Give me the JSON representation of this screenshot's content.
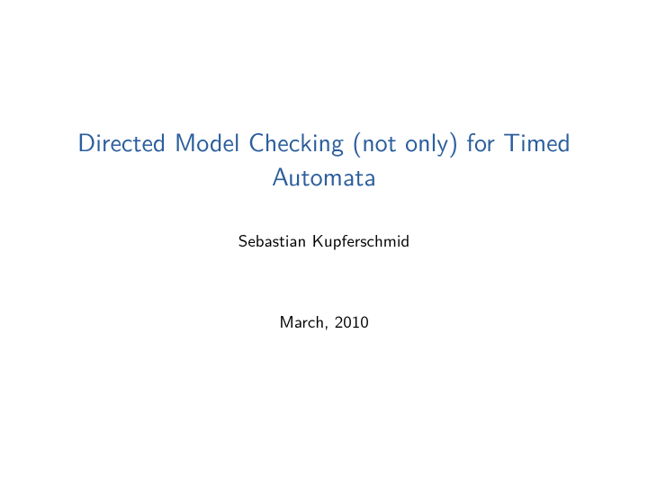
{
  "title_line1": "Directed Model Checking (not only) for Timed",
  "title_line2": "Automata",
  "author": "Sebastian Kupferschmid",
  "date": "March, 2010"
}
